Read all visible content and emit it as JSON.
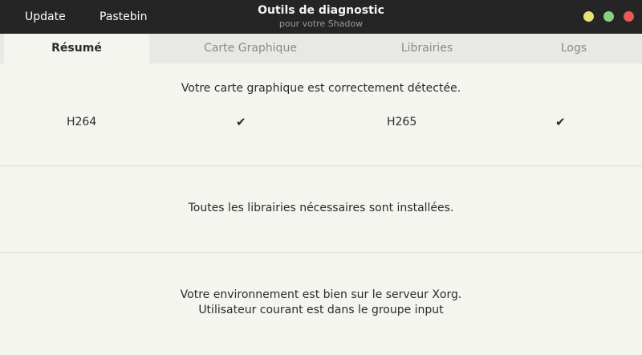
{
  "header": {
    "update_label": "Update",
    "pastebin_label": "Pastebin",
    "title": "Outils de diagnostic",
    "subtitle": "pour votre Shadow",
    "window_buttons": [
      {
        "name": "minimize",
        "color": "#e6e374"
      },
      {
        "name": "maximize",
        "color": "#8ad082"
      },
      {
        "name": "close",
        "color": "#e85a54"
      }
    ]
  },
  "tabs": [
    {
      "label": "Résumé",
      "active": true
    },
    {
      "label": "Carte Graphique",
      "active": false
    },
    {
      "label": "Librairies",
      "active": false
    },
    {
      "label": "Logs",
      "active": false
    }
  ],
  "summary": {
    "gpu_message": "Votre carte graphique est correctement détectée.",
    "codecs": [
      {
        "label": "H264",
        "check": "✔"
      },
      {
        "label": "H265",
        "check": "✔"
      }
    ],
    "libraries_message": "Toutes les librairies nécessaires sont installées.",
    "environment_message": "Votre environnement est bien sur le serveur Xorg.",
    "input_group_message": "Utilisateur courant est dans le groupe input"
  },
  "colors": {
    "headerbar": "#252525",
    "background": "#f5f5f0",
    "tabbar": "#e8e8e4"
  }
}
